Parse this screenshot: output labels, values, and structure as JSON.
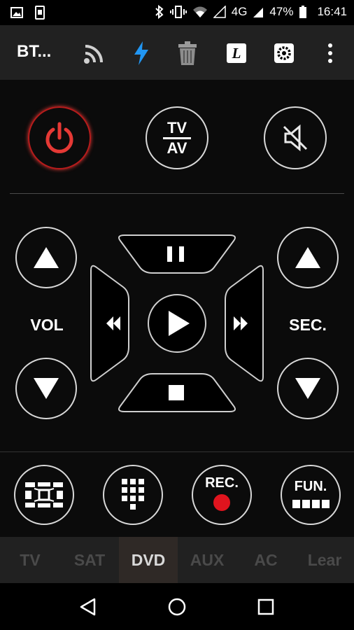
{
  "status_bar": {
    "battery_percent": "47%",
    "time": "16:41",
    "network": "4G",
    "icons": [
      "image-icon",
      "screenshot-icon",
      "bluetooth-icon",
      "vibrate-icon",
      "wifi-icon",
      "signal-empty-icon",
      "signal-4g-icon",
      "battery-icon"
    ]
  },
  "toolbar": {
    "title": "BT...",
    "icons": [
      "cast-icon",
      "flash-icon",
      "trash-icon",
      "learn-l-icon",
      "settings-icon",
      "more-vert-icon"
    ],
    "learn_letter": "L",
    "accent_color": "#2196f3"
  },
  "remote": {
    "power_color": "#e53935",
    "tv_av": {
      "top": "TV",
      "bottom": "AV"
    },
    "vol_label": "VOL",
    "sec_label": "SEC.",
    "rec_label": "REC.",
    "fun_label": "FUN.",
    "rec_dot_color": "#e0141e"
  },
  "tabs": {
    "items": [
      "TV",
      "SAT",
      "DVD",
      "AUX",
      "AC",
      "Lear"
    ],
    "active": "DVD"
  }
}
